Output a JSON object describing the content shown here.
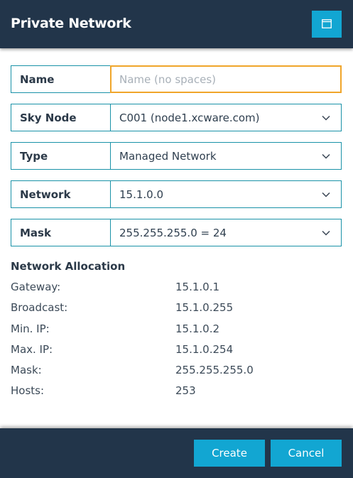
{
  "dialog": {
    "title": "Private Network"
  },
  "form": {
    "name": {
      "label": "Name",
      "value": "",
      "placeholder": "Name (no spaces)"
    },
    "sky_node": {
      "label": "Sky Node",
      "value": "C001 (node1.xcware.com)"
    },
    "type": {
      "label": "Type",
      "value": "Managed Network"
    },
    "network": {
      "label": "Network",
      "value": "15.1.0.0"
    },
    "mask": {
      "label": "Mask",
      "value": "255.255.255.0 = 24"
    }
  },
  "allocation": {
    "title": "Network Allocation",
    "rows": [
      {
        "key": "Gateway:",
        "value": "15.1.0.1"
      },
      {
        "key": "Broadcast:",
        "value": "15.1.0.255"
      },
      {
        "key": "Min. IP:",
        "value": "15.1.0.2"
      },
      {
        "key": "Max. IP:",
        "value": "15.1.0.254"
      },
      {
        "key": "Mask:",
        "value": "255.255.255.0"
      },
      {
        "key": "Hosts:",
        "value": "253"
      }
    ]
  },
  "footer": {
    "create_label": "Create",
    "cancel_label": "Cancel"
  },
  "colors": {
    "header_bg": "#22354a",
    "accent": "#12a6d2",
    "field_border": "#1a92a8",
    "focus_border": "#f0a52a"
  },
  "icons": {
    "window": "window-icon",
    "dropdown": "chevron-down-icon"
  }
}
